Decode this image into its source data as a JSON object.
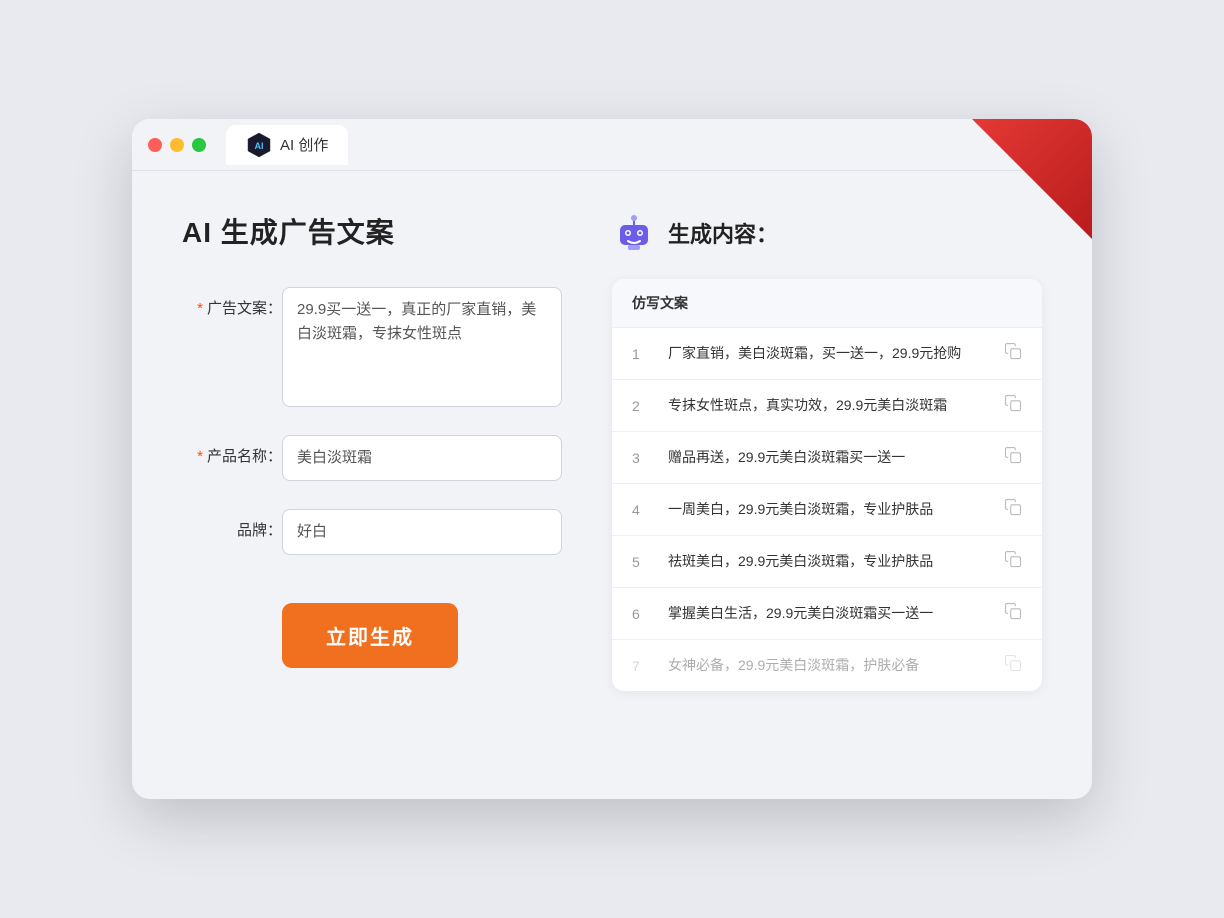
{
  "browser": {
    "tab_title": "AI 创作",
    "traffic_lights": [
      "red",
      "yellow",
      "green"
    ]
  },
  "left_panel": {
    "page_title": "AI 生成广告文案",
    "form": {
      "ad_copy_label": "广告文案：",
      "ad_copy_required": true,
      "ad_copy_value": "29.9买一送一，真正的厂家直销，美白淡斑霜，专抹女性斑点",
      "product_name_label": "产品名称：",
      "product_name_required": true,
      "product_name_value": "美白淡斑霜",
      "brand_label": "品牌：",
      "brand_required": false,
      "brand_value": "好白"
    },
    "generate_button": "立即生成"
  },
  "right_panel": {
    "result_title": "生成内容：",
    "table_header": "仿写文案",
    "results": [
      {
        "num": 1,
        "text": "厂家直销，美白淡斑霜，买一送一，29.9元抢购",
        "faded": false
      },
      {
        "num": 2,
        "text": "专抹女性斑点，真实功效，29.9元美白淡斑霜",
        "faded": false
      },
      {
        "num": 3,
        "text": "赠品再送，29.9元美白淡斑霜买一送一",
        "faded": false
      },
      {
        "num": 4,
        "text": "一周美白，29.9元美白淡斑霜，专业护肤品",
        "faded": false
      },
      {
        "num": 5,
        "text": "祛斑美白，29.9元美白淡斑霜，专业护肤品",
        "faded": false
      },
      {
        "num": 6,
        "text": "掌握美白生活，29.9元美白淡斑霜买一送一",
        "faded": false
      },
      {
        "num": 7,
        "text": "女神必备，29.9元美白淡斑霜，护肤必备",
        "faded": true
      }
    ]
  }
}
